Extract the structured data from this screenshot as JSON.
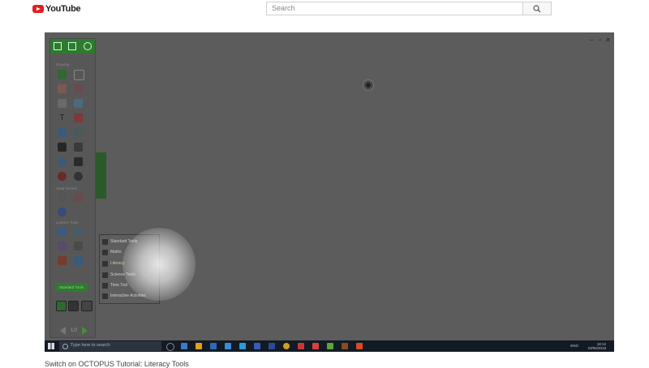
{
  "header": {
    "logo_text": "YouTube",
    "search_placeholder": "Search"
  },
  "octopus": {
    "toolbar_labels": [
      "Drawing",
      "Clear Screen",
      "Lockers Tools"
    ],
    "standard_tools_label": "Standard Tools",
    "menu_items": [
      {
        "label": "Standard Tools",
        "icon": "grid-icon",
        "active": false
      },
      {
        "label": "Maths",
        "icon": "calculator-icon",
        "active": false
      },
      {
        "label": "Literacy",
        "icon": "book-icon",
        "active": true
      },
      {
        "label": "Science Tools",
        "icon": "flask-icon",
        "active": false
      },
      {
        "label": "Time Tool",
        "icon": "clock-icon",
        "active": false
      },
      {
        "label": "Interactive Activities",
        "icon": "puzzle-icon",
        "active": false
      }
    ],
    "page_counter": "1/2"
  },
  "taskbar": {
    "search_placeholder": "Type here to search",
    "clock_time": "18:12",
    "clock_date": "23/06/2018",
    "language": "ENG"
  },
  "video": {
    "title": "Switch on OCTOPUS Tutorial: Literacy Tools"
  },
  "colors": {
    "accent_green": "#2e7a2e",
    "youtube_red": "#e02020"
  }
}
